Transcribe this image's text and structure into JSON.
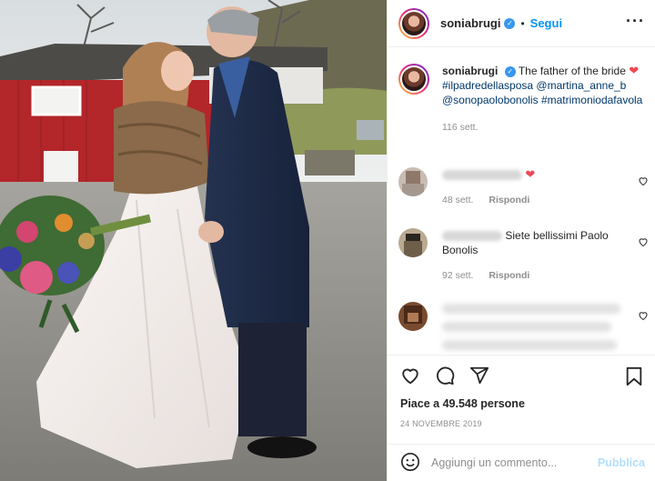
{
  "post": {
    "image_alt": "Bride and father kissing in front of a red barn"
  },
  "header": {
    "username": "soniabrugi",
    "separator": "•",
    "follow_label": "Segui",
    "more_label": "···"
  },
  "caption": {
    "username": "soniabrugi",
    "text": "The father of the bride",
    "heart": "❤",
    "tags": [
      "#ilpadredellasposa",
      "@martina_anne_b",
      "@sonopaolobonolis",
      "#matrimoniodafavola"
    ],
    "time": "116 sett."
  },
  "comments": [
    {
      "text": "",
      "heart": "❤",
      "time": "48 sett.",
      "reply_label": "Rispondi"
    },
    {
      "text": "Siete bellissimi Paolo Bonolis",
      "time": "92 sett.",
      "reply_label": "Rispondi"
    },
    {
      "text": "",
      "time": "",
      "reply_label": ""
    }
  ],
  "actions": {
    "like_icon": "heart-outline-icon",
    "comment_icon": "comment-icon",
    "share_icon": "paper-plane-icon",
    "save_icon": "bookmark-icon",
    "likes": "Piace a 49.548 persone",
    "date": "24 NOVEMBRE 2019"
  },
  "add_comment": {
    "placeholder": "Aggiungi un commento...",
    "publish_label": "Pubblica"
  },
  "colors": {
    "accent": "#0095f6",
    "verified": "#3897f0",
    "heart": "#ed4956",
    "publish_disabled": "#b2dffc",
    "barn_red": "#b3262a"
  }
}
